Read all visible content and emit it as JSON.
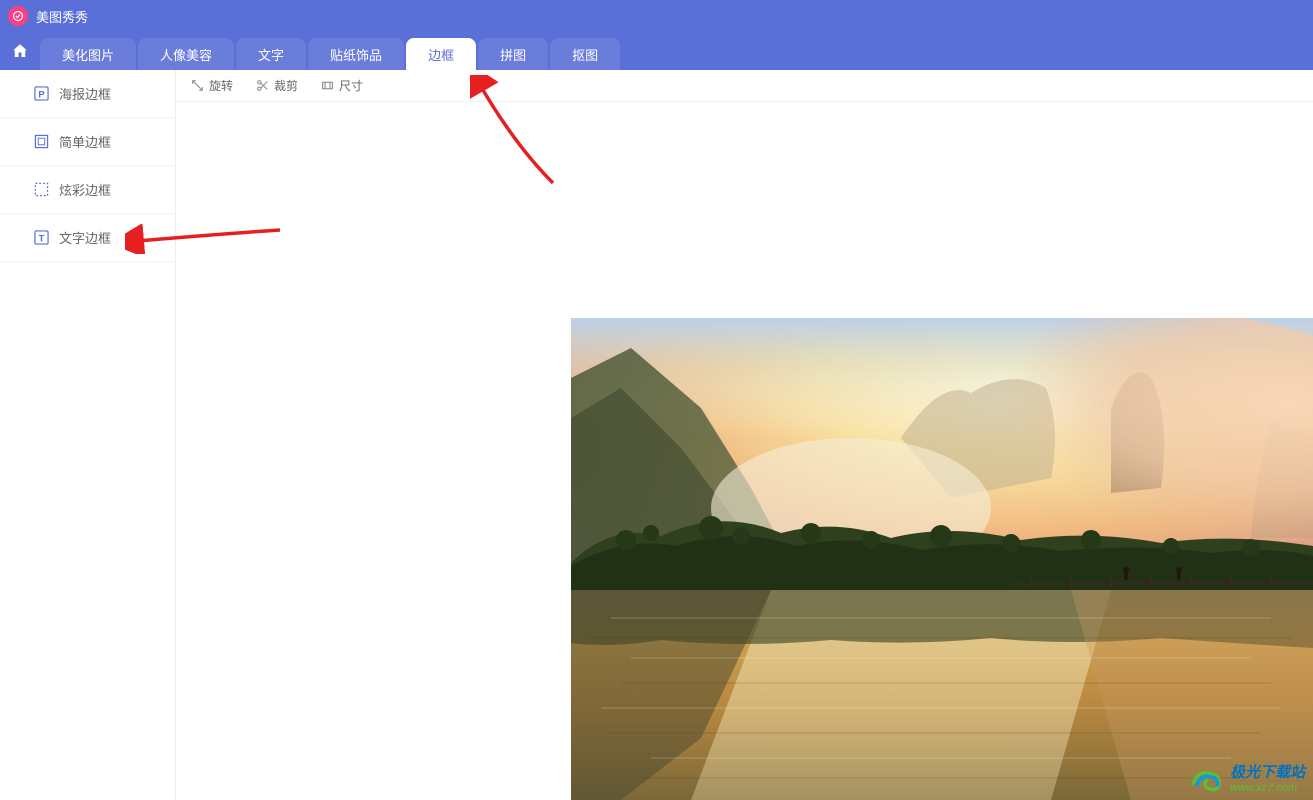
{
  "app": {
    "title": "美图秀秀"
  },
  "nav": {
    "tabs": [
      {
        "label": "美化图片"
      },
      {
        "label": "人像美容"
      },
      {
        "label": "文字"
      },
      {
        "label": "贴纸饰品"
      },
      {
        "label": "边框",
        "active": true
      },
      {
        "label": "拼图"
      },
      {
        "label": "抠图"
      }
    ]
  },
  "toolbar": {
    "rotate": "旋转",
    "crop": "裁剪",
    "size": "尺寸"
  },
  "sidebar": {
    "items": [
      {
        "label": "海报边框",
        "icon": "P"
      },
      {
        "label": "简单边框",
        "icon": "square"
      },
      {
        "label": "炫彩边框",
        "icon": "dashed"
      },
      {
        "label": "文字边框",
        "icon": "T"
      }
    ]
  },
  "watermark": {
    "line1": "极光下载站",
    "line2": "www.xz7.com"
  }
}
